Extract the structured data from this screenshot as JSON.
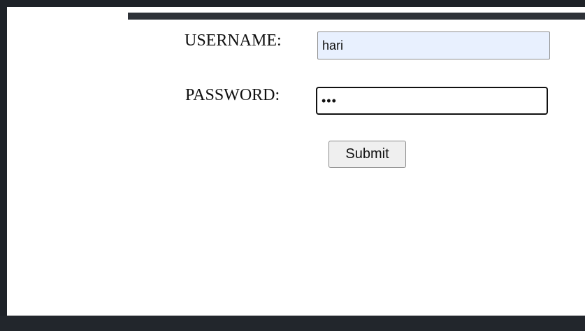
{
  "form": {
    "username_label": "USERNAME:",
    "username_value": "hari",
    "password_label": "PASSWORD:",
    "password_value": "abc",
    "submit_label": "Submit"
  },
  "colors": {
    "username_field_bg": "#e8f0fe",
    "frame_bg": "#1e2228"
  }
}
